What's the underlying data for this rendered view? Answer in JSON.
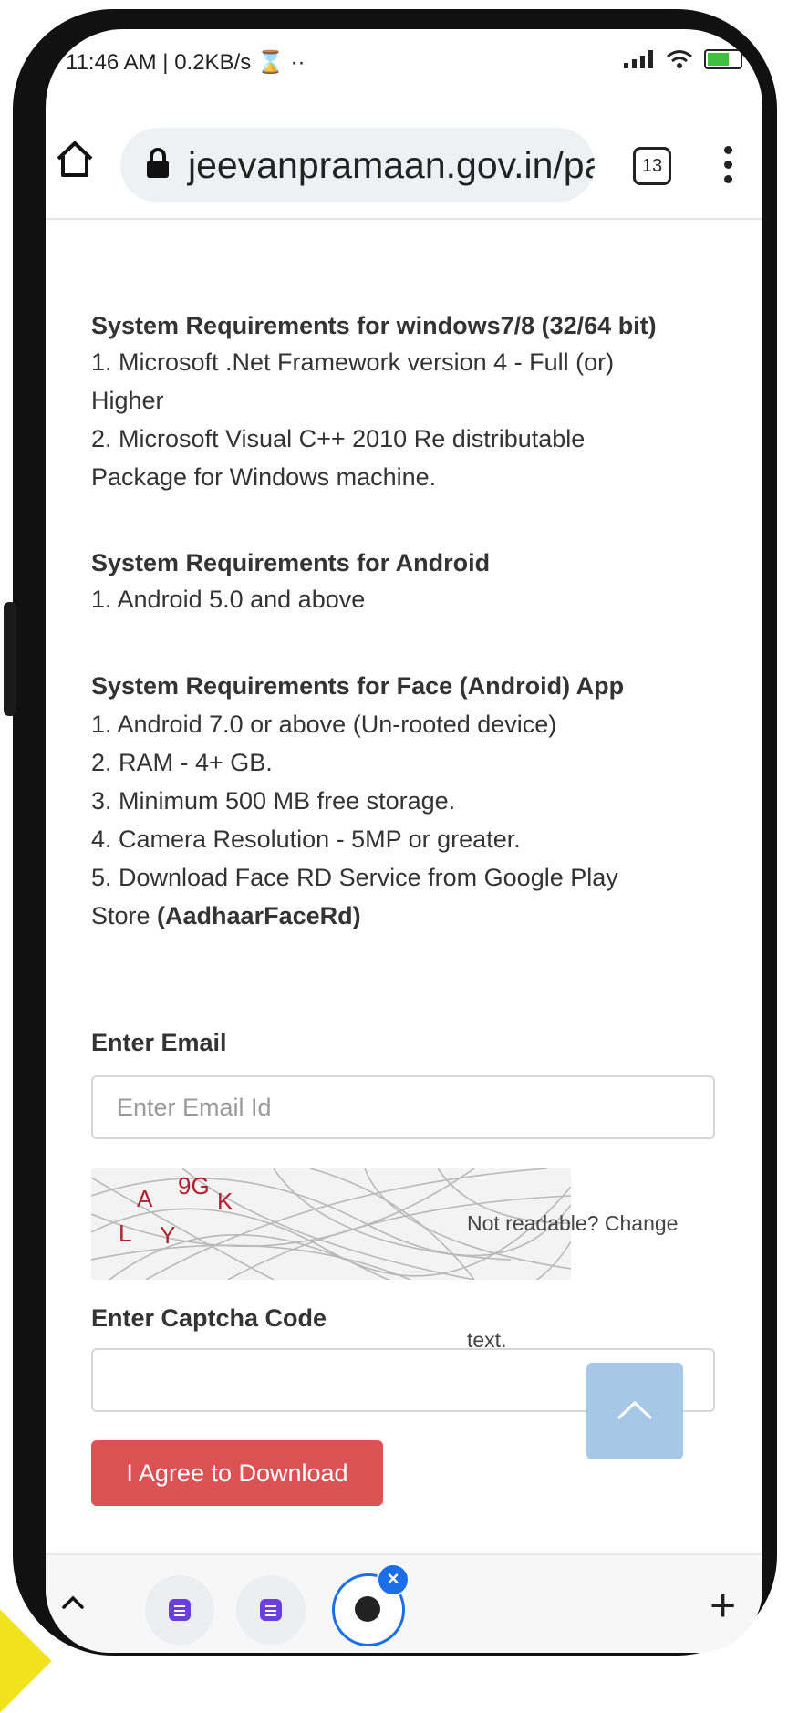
{
  "status_bar": {
    "left_text": "11:46 AM | 0.2KB/s ⌛ ··",
    "battery_level": 0.6
  },
  "browser": {
    "url": "jeevanpramaan.gov.in/pa",
    "tab_count": "13"
  },
  "page": {
    "sections": [
      {
        "title": "System Requirements for windows7/8 (32/64 bit)",
        "lines": [
          "  1. Microsoft .Net Framework version 4 - Full (or)",
          "Higher",
          "  2. Microsoft Visual C++ 2010 Re distributable",
          "Package for Windows machine."
        ]
      },
      {
        "title": "System Requirements for Android",
        "lines": [
          "  1. Android 5.0 and above"
        ]
      },
      {
        "title": "System Requirements for Face (Android) App",
        "lines": [
          "  1. Android 7.0 or above (Un-rooted device)",
          "  2. RAM - 4+ GB.",
          "  3. Minimum 500 MB free storage.",
          "  4. Camera Resolution - 5MP or greater.",
          "  5. Download Face RD Service from Google Play"
        ]
      }
    ],
    "store_prefix": "Store ",
    "store_app": "(AadhaarFaceRd)",
    "email_label": "Enter Email",
    "email_placeholder": "Enter Email Id",
    "captcha_chars": [
      "A",
      "9G",
      "K",
      "L",
      "Y"
    ],
    "captcha_change_1": "Not readable? Change",
    "captcha_change_2": "text.",
    "captcha_label": "Enter Captcha Code",
    "agree_button": "I Agree to Download"
  },
  "bottom_bar": {
    "close_label": "×",
    "plus_label": "+"
  }
}
